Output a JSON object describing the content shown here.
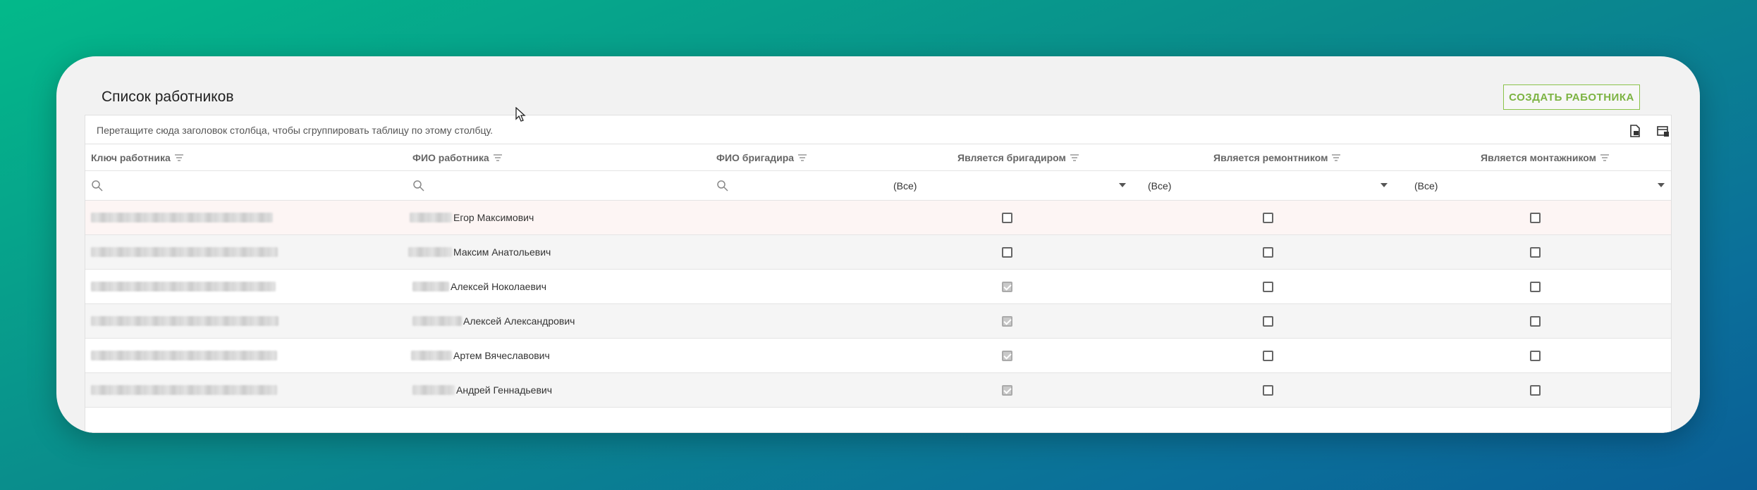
{
  "page": {
    "title": "Список работников",
    "create_button": "СОЗДАТЬ РАБОТНИКА"
  },
  "grid": {
    "group_hint": "Перетащите сюда заголовок столбца, чтобы сгруппировать таблицу по этому столбцу.",
    "toolbar_icons": [
      "export-excel-icon",
      "column-chooser-icon"
    ],
    "columns": [
      "Ключ работника",
      "ФИО работника",
      "ФИО бригадира",
      "Является бригадиром",
      "Является ремонтником",
      "Является монтажником"
    ],
    "filters": {
      "is_foreman": "(Все)",
      "is_repairman": "(Все)",
      "is_installer": "(Все)"
    },
    "rows": [
      {
        "name": "Егор Максимович",
        "is_foreman": false,
        "is_repairman": false,
        "is_installer": false
      },
      {
        "name": "Максим Анатольевич",
        "is_foreman": false,
        "is_repairman": false,
        "is_installer": false
      },
      {
        "name": "Алексей Ноколаевич",
        "is_foreman": true,
        "is_repairman": false,
        "is_installer": false
      },
      {
        "name": "Алексей Александрович",
        "is_foreman": true,
        "is_repairman": false,
        "is_installer": false
      },
      {
        "name": "Артем Вячеславович",
        "is_foreman": true,
        "is_repairman": false,
        "is_installer": false
      },
      {
        "name": "Андрей Геннадьевич",
        "is_foreman": true,
        "is_repairman": false,
        "is_installer": false
      }
    ]
  },
  "colors": {
    "accent": "#7cb342",
    "hover_row": "#fdf5f4",
    "alt_row": "#f5f5f5"
  }
}
